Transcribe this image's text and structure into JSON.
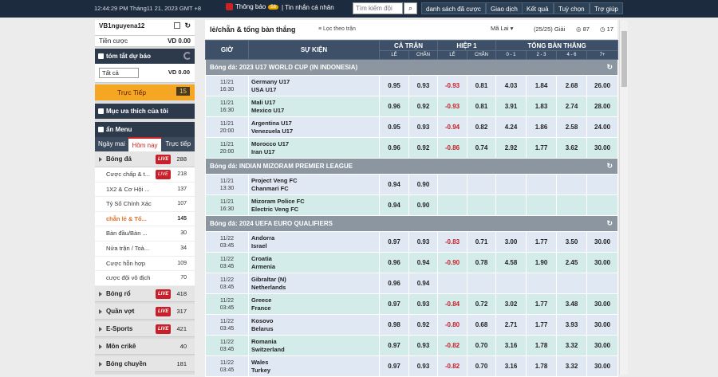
{
  "topbar": {
    "clock": "12:44:29 PM Tháng11 21, 2023 GMT +8",
    "notif_label": "Thông báo",
    "notif_badge": "56",
    "notif2": "| Tin nhắn cá nhân",
    "search_placeholder": "Tìm kiếm đội",
    "nav": [
      "danh sách đã cược",
      "Giao dịch",
      "Kết quả",
      "Tuỳ chọn",
      "Trợ giúp"
    ]
  },
  "account": {
    "username": "VB1nguyena12",
    "bet_label": "Tiền cược",
    "bet_value": "VD 0.00"
  },
  "summary": {
    "title": "tóm tắt dự báo",
    "select": "Tất cả",
    "value": "VD 0.00",
    "live_label": "Trực Tiếp",
    "live_count": "15"
  },
  "fav": {
    "title": "Mục ưa thích của tôi"
  },
  "menu": {
    "title": "ẩn Menu",
    "tabs": [
      "Ngày mai",
      "Hôm nay",
      "Trực tiếp"
    ],
    "sports": [
      {
        "name": "Bóng đá",
        "live": "LIVE",
        "count": "288"
      }
    ],
    "subs": [
      {
        "name": "Cược chấp & t...",
        "live": "LIVE",
        "count": "218"
      },
      {
        "name": "1X2 & Cơ Hội ...",
        "count": "137"
      },
      {
        "name": "Tỷ Số Chính Xác",
        "count": "107"
      },
      {
        "name": "chẵn lẻ & Tổ...",
        "count": "145"
      },
      {
        "name": "Bàn đầu/Bàn ...",
        "count": "30"
      },
      {
        "name": "Nửa trận / Toà...",
        "count": "34"
      },
      {
        "name": "Cược hỗn hợp",
        "count": "109"
      },
      {
        "name": "cược đội vô địch",
        "count": "70"
      }
    ],
    "sports2": [
      {
        "name": "Bóng rổ",
        "live": "LIVE",
        "count": "418"
      },
      {
        "name": "Quần vợt",
        "live": "LIVE",
        "count": "317"
      },
      {
        "name": "E-Sports",
        "live": "LIVE",
        "count": "421"
      },
      {
        "name": "Môn crikê",
        "count": "40"
      },
      {
        "name": "Bóng chuyền",
        "count": "181"
      }
    ]
  },
  "main": {
    "title": "lẻ/chẵn & tổng bàn thắng",
    "filter": "Lọc theo trận",
    "odds_type": "Mã Lai",
    "league_count": "(25/25) Giải",
    "c1": "87",
    "c2": "17",
    "headers": {
      "time": "GIỜ",
      "event": "SỰ KIỆN",
      "full": "CẢ TRẬN",
      "half": "HIỆP 1",
      "total": "TỔNG BÀN THẮNG",
      "le": "LẺ",
      "chan": "CHẴN",
      "t1": "0 - 1",
      "t2": "2 - 3",
      "t3": "4 - 6",
      "t4": "7+"
    },
    "leagues": [
      {
        "name": "Bóng đá: 2023 U17 WORLD CUP (IN INDONESIA)",
        "matches": [
          {
            "date": "11/21",
            "time": "16:30",
            "home": "Germany U17",
            "away": "USA U17",
            "le": "0.95",
            "chan": "0.93",
            "hle": "-0.93",
            "hchan": "0.81",
            "t1": "4.03",
            "t2": "1.84",
            "t3": "2.68",
            "t4": "26.00"
          },
          {
            "date": "11/21",
            "time": "16:30",
            "home": "Mali U17",
            "away": "Mexico U17",
            "le": "0.96",
            "chan": "0.92",
            "hle": "-0.93",
            "hchan": "0.81",
            "t1": "3.91",
            "t2": "1.83",
            "t3": "2.74",
            "t4": "28.00"
          },
          {
            "date": "11/21",
            "time": "20:00",
            "home": "Argentina U17",
            "away": "Venezuela U17",
            "le": "0.95",
            "chan": "0.93",
            "hle": "-0.94",
            "hchan": "0.82",
            "t1": "4.24",
            "t2": "1.86",
            "t3": "2.58",
            "t4": "24.00"
          },
          {
            "date": "11/21",
            "time": "20:00",
            "home": "Morocco U17",
            "away": "Iran U17",
            "le": "0.96",
            "chan": "0.92",
            "hle": "-0.86",
            "hchan": "0.74",
            "t1": "2.92",
            "t2": "1.77",
            "t3": "3.62",
            "t4": "30.00"
          }
        ]
      },
      {
        "name": "Bóng đá: INDIAN MIZORAM PREMIER LEAGUE",
        "matches": [
          {
            "date": "11/21",
            "time": "13:30",
            "home": "Project Veng FC",
            "away": "Chanmari FC",
            "le": "0.94",
            "chan": "0.90",
            "hle": "",
            "hchan": "",
            "t1": "",
            "t2": "",
            "t3": "",
            "t4": ""
          },
          {
            "date": "11/21",
            "time": "16:30",
            "home": "Mizoram Police FC",
            "away": "Electric Veng FC",
            "le": "0.94",
            "chan": "0.90",
            "hle": "",
            "hchan": "",
            "t1": "",
            "t2": "",
            "t3": "",
            "t4": ""
          }
        ]
      },
      {
        "name": "Bóng đá: 2024 UEFA EURO QUALIFIERS",
        "matches": [
          {
            "date": "11/22",
            "time": "03:45",
            "home": "Andorra",
            "away": "Israel",
            "le": "0.97",
            "chan": "0.93",
            "hle": "-0.83",
            "hchan": "0.71",
            "t1": "3.00",
            "t2": "1.77",
            "t3": "3.50",
            "t4": "30.00"
          },
          {
            "date": "11/22",
            "time": "03:45",
            "home": "Croatia",
            "away": "Armenia",
            "le": "0.96",
            "chan": "0.94",
            "hle": "-0.90",
            "hchan": "0.78",
            "t1": "4.58",
            "t2": "1.90",
            "t3": "2.45",
            "t4": "30.00"
          },
          {
            "date": "11/22",
            "time": "03:45",
            "home": "Gibraltar (N)",
            "away": "Netherlands",
            "le": "0.96",
            "chan": "0.94",
            "hle": "",
            "hchan": "",
            "t1": "",
            "t2": "",
            "t3": "",
            "t4": ""
          },
          {
            "date": "11/22",
            "time": "03:45",
            "home": "Greece",
            "away": "France",
            "le": "0.97",
            "chan": "0.93",
            "hle": "-0.84",
            "hchan": "0.72",
            "t1": "3.02",
            "t2": "1.77",
            "t3": "3.48",
            "t4": "30.00"
          },
          {
            "date": "11/22",
            "time": "03:45",
            "home": "Kosovo",
            "away": "Belarus",
            "le": "0.98",
            "chan": "0.92",
            "hle": "-0.80",
            "hchan": "0.68",
            "t1": "2.71",
            "t2": "1.77",
            "t3": "3.93",
            "t4": "30.00"
          },
          {
            "date": "11/22",
            "time": "03:45",
            "home": "Romania",
            "away": "Switzerland",
            "le": "0.97",
            "chan": "0.93",
            "hle": "-0.82",
            "hchan": "0.70",
            "t1": "3.16",
            "t2": "1.78",
            "t3": "3.32",
            "t4": "30.00"
          },
          {
            "date": "11/22",
            "time": "03:45",
            "home": "Wales",
            "away": "Turkey",
            "le": "0.97",
            "chan": "0.93",
            "hle": "-0.82",
            "hchan": "0.70",
            "t1": "3.16",
            "t2": "1.78",
            "t3": "3.32",
            "t4": "30.00"
          }
        ]
      }
    ]
  }
}
